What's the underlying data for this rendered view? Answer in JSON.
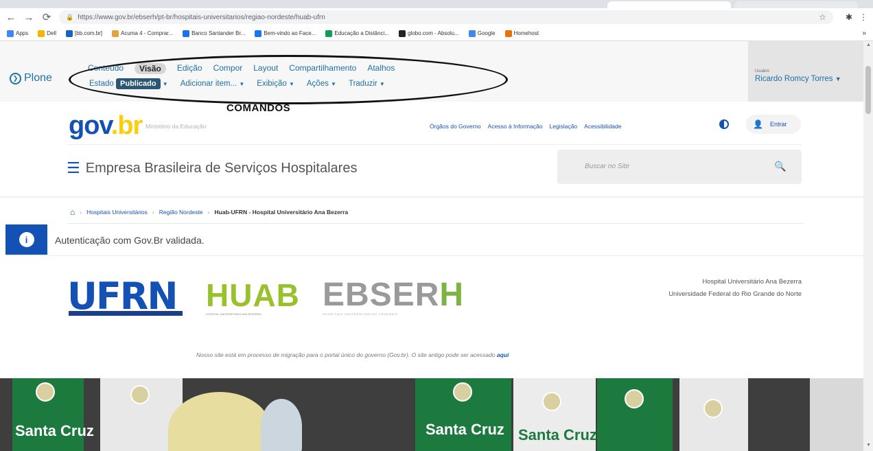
{
  "browser": {
    "url": "https://www.gov.br/ebserh/pt-br/hospitais-universitarios/regiao-nordeste/huab-ufrn",
    "bookmarks": [
      {
        "label": "Apps",
        "color": "#4285f4"
      },
      {
        "label": "Dell",
        "color": "#f4b400"
      },
      {
        "label": "[bb.com.br]",
        "color": "#1565c0"
      },
      {
        "label": "Acuma 4 - Comprar...",
        "color": "#e6a23c"
      },
      {
        "label": "Banco Santander Br...",
        "color": "#1a73e8"
      },
      {
        "label": "Bem-vindo ao Face...",
        "color": "#1877f2"
      },
      {
        "label": "Educação a Distânci...",
        "color": "#0f9d58"
      },
      {
        "label": "globo.com - Absolu...",
        "color": "#222222"
      },
      {
        "label": "Google",
        "color": "#4285f4"
      },
      {
        "label": "Homehost",
        "color": "#e8710a"
      }
    ]
  },
  "plone": {
    "logo_text": "Plone",
    "row1": [
      "Conteúdo",
      "Visão",
      "Edição",
      "Compor",
      "Layout",
      "Compartilhamento",
      "Atalhos"
    ],
    "row1_active": "Visão",
    "row2": {
      "estado_label": "Estado",
      "estado_value": "Publicado",
      "items": [
        "Adicionar item...",
        "Exibição",
        "Ações",
        "Traduzir"
      ]
    },
    "annotation": "COMANDOS",
    "user_label": "Usuário",
    "user_name": "Ricardo Romcy Torres"
  },
  "gov": {
    "logo_g": "gov",
    "logo_v": ".br",
    "ministerio": "Ministério da Educação",
    "top_links": [
      "Órgãos do Governo",
      "Acesso à Informação",
      "Legislação",
      "Acessibilidade"
    ],
    "entrar": "Entrar",
    "site_title": "Empresa Brasileira de Serviços Hospitalares",
    "search_placeholder": "Buscar no Site"
  },
  "breadcrumb": {
    "items": [
      "Hospitais Universitários",
      "Região Nordeste"
    ],
    "current": "Huab-UFRN - Hospital Universitário Ana Bezerra"
  },
  "alert": {
    "text": "Autenticação com Gov.Br validada."
  },
  "logos": {
    "ufrn": "UFRN",
    "huab": "HUAB",
    "huab_sub": "HOSPITAL UNIVERSITÁRIO ANA BEZERRA",
    "ebserh_main": "EBSER",
    "ebserh_h": "H",
    "ebserh_sub": "HOSPITAIS UNIVERSITÁRIOS FEDERAIS"
  },
  "hospital": {
    "line1": "Hospital Universitário Ana Bezerra",
    "line2": "Universidade Federal do Rio Grande do Norte"
  },
  "migration": {
    "text": "Nosso site está em processo de migração para o portal único do governo (Gov.br). O site antigo pode ser acessado",
    "link": "aqui"
  },
  "photo": {
    "banner_text": "Santa Cruz"
  }
}
